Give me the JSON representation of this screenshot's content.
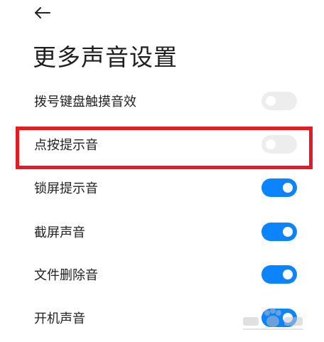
{
  "page_title": "更多声音设置",
  "icons": {
    "back": "arrow-left-icon"
  },
  "colors": {
    "toggle_on": "#0d84ff",
    "toggle_off": "#ededed",
    "highlight_border": "#e51a23"
  },
  "settings": [
    {
      "label": "拨号键盘触摸音效",
      "enabled": false
    },
    {
      "label": "点按提示音",
      "enabled": false,
      "highlighted": true
    },
    {
      "label": "锁屏提示音",
      "enabled": true
    },
    {
      "label": "截屏声音",
      "enabled": true
    },
    {
      "label": "文件删除音",
      "enabled": true
    },
    {
      "label": "开机声音",
      "enabled": true
    }
  ]
}
